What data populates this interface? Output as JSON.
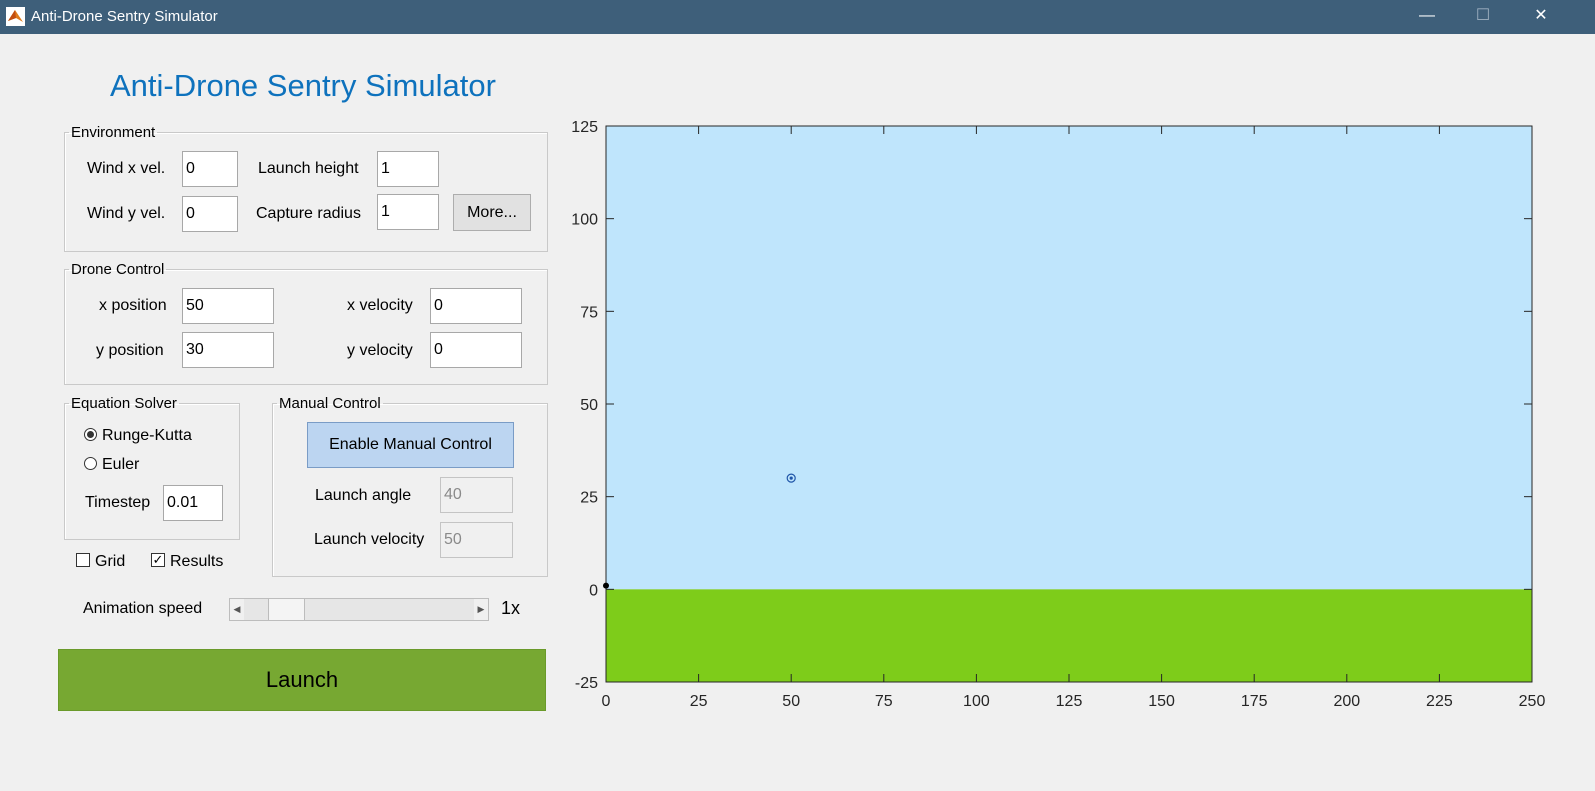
{
  "window": {
    "title": "Anti-Drone Sentry Simulator",
    "minimize": "—",
    "maximize": "☐",
    "close": "✕"
  },
  "heading": "Anti-Drone Sentry Simulator",
  "environment": {
    "legend": "Environment",
    "wind_x_label": "Wind x vel.",
    "wind_x_value": "0",
    "wind_y_label": "Wind y vel.",
    "wind_y_value": "0",
    "launch_height_label": "Launch height",
    "launch_height_value": "1",
    "capture_radius_label": "Capture radius",
    "capture_radius_value": "1",
    "more_label": "More..."
  },
  "drone_control": {
    "legend": "Drone Control",
    "x_position_label": "x position",
    "x_position_value": "50",
    "y_position_label": "y position",
    "y_position_value": "30",
    "x_velocity_label": "x velocity",
    "x_velocity_value": "0",
    "y_velocity_label": "y velocity",
    "y_velocity_value": "0"
  },
  "equation_solver": {
    "legend": "Equation Solver",
    "options": [
      "Runge-Kutta",
      "Euler"
    ],
    "selected": "Runge-Kutta",
    "timestep_label": "Timestep",
    "timestep_value": "0.01"
  },
  "manual_control": {
    "legend": "Manual Control",
    "enable_label": "Enable Manual Control",
    "launch_angle_label": "Launch angle",
    "launch_angle_value": "40",
    "launch_velocity_label": "Launch velocity",
    "launch_velocity_value": "50"
  },
  "options": {
    "grid_label": "Grid",
    "grid_checked": false,
    "results_label": "Results",
    "results_checked": true
  },
  "animation": {
    "label": "Animation speed",
    "speed_text": "1x",
    "slider_fraction": 0.12
  },
  "launch_label": "Launch",
  "chart_data": {
    "type": "scatter",
    "xlim": [
      0,
      250
    ],
    "ylim": [
      -25,
      125
    ],
    "xticks": [
      0,
      25,
      50,
      75,
      100,
      125,
      150,
      175,
      200,
      225,
      250
    ],
    "yticks": [
      -25,
      0,
      25,
      50,
      75,
      100,
      125
    ],
    "sky_color": "#bfe5fc",
    "ground_color": "#7ecc1a",
    "ground_level": 0,
    "drone": {
      "x": 50,
      "y": 30
    },
    "launcher": {
      "x": 0,
      "y": 1
    },
    "grid": false
  }
}
